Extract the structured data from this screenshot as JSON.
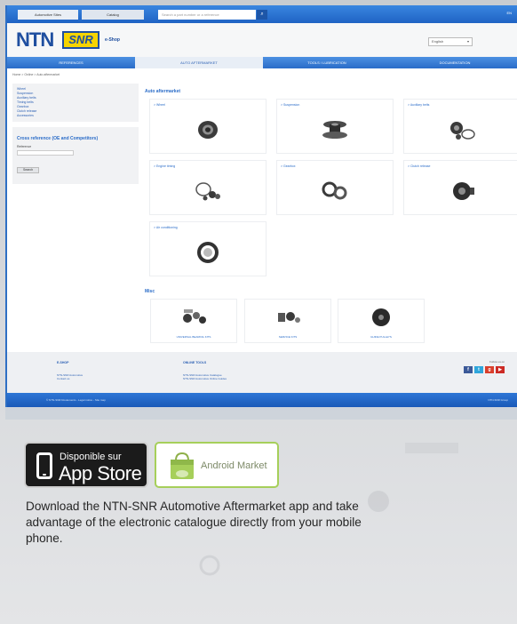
{
  "topbar": {
    "tab_a": "Automotive Sites",
    "tab_b": "Catalog",
    "search_placeholder": "Search a part number or a reference",
    "lang": "EN"
  },
  "header": {
    "brand_ntn": "NTN",
    "brand_snr": "SNR",
    "eshop": "e-Shop",
    "select_value": "English"
  },
  "nav": {
    "items": [
      {
        "label": "REFERENCES",
        "active": false
      },
      {
        "label": "AUTO AFTERMARKET",
        "active": true
      },
      {
        "label": "TOOLS / LUBRICATION",
        "active": false
      },
      {
        "label": "DOCUMENTATION",
        "active": false
      }
    ]
  },
  "breadcrumb": "Home > Online > Auto aftermarket",
  "sidebar": {
    "links": [
      "Wheel",
      "Suspension",
      "Auxiliary belts",
      "Timing belts",
      "Gearbox",
      "Clutch release",
      "Accessories"
    ],
    "cross_title": "Cross reference (OE and Competitors)",
    "cross_label": "Reference",
    "cross_button": "Search"
  },
  "content": {
    "title": "Auto aftermarket",
    "cards": [
      {
        "label": "> Wheel"
      },
      {
        "label": "> Suspension"
      },
      {
        "label": "> Auxiliary belts"
      },
      {
        "label": "> Engine timing"
      },
      {
        "label": "> Gearbox"
      },
      {
        "label": "> Clutch release"
      },
      {
        "label": "> Air conditioning"
      }
    ],
    "misc_title": "Misc",
    "misc_cards": [
      {
        "label": "UNIVERSAL BEARING KITS"
      },
      {
        "label": "SERVICE KITS"
      },
      {
        "label": "GUIDE PULLEYS"
      }
    ]
  },
  "footer": {
    "col1_head": "E-SHOP",
    "col1_links": [
      "NTN-SNR Automotive",
      "Contact us"
    ],
    "col2_head": "ONLINE TOOLS",
    "col2_links": [
      "NTN-SNR Automotive Catalogue",
      "NTN-SNR Automotive Online Guides"
    ],
    "follow": "Follow us on",
    "copyright": "© NTN-SNR Roulements - Legal notice - Site map",
    "copyright_right": "NTN-SNR Group"
  },
  "promo": {
    "appstore_small": "Disponible sur",
    "appstore_big": "App Store",
    "android": "Android Market",
    "description": "Download the NTN-SNR Automotive Aftermarket app and take advantage of the electronic catalogue directly from your mobile phone."
  },
  "colors": {
    "brand_blue": "#2a6cc8",
    "brand_yellow": "#f6d400",
    "android_green": "#a6cf5a"
  }
}
